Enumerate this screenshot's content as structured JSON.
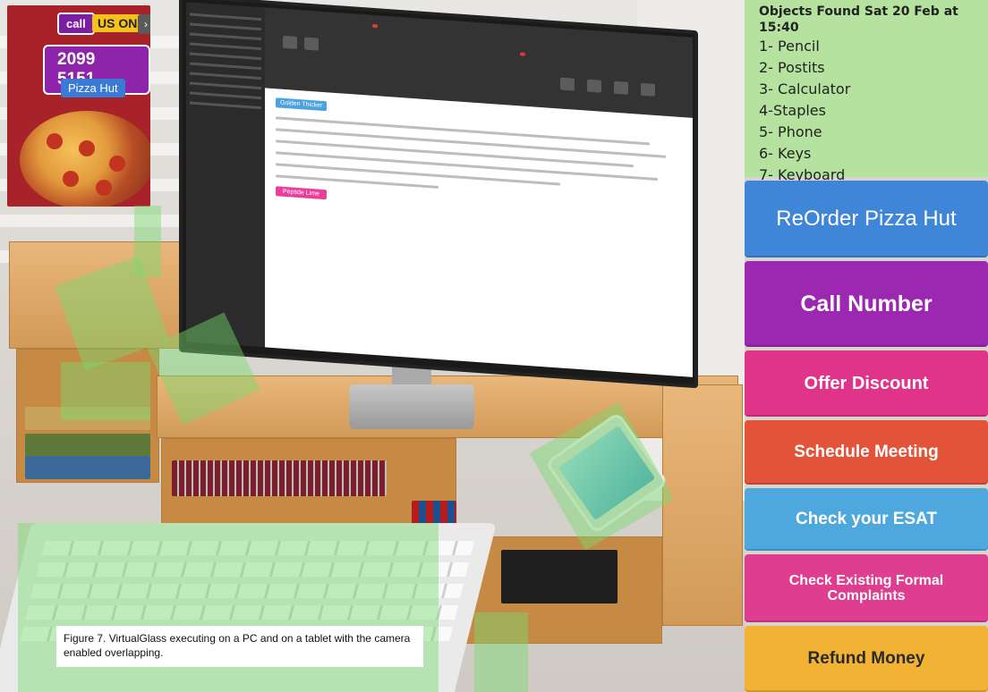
{
  "ad": {
    "call": "call",
    "uson": "US ON",
    "next": "›",
    "phone": "2099 5151",
    "brand": "Pizza Hut"
  },
  "email": {
    "button_pink": "Peptide Lime",
    "button_blue": "Golden Thicker"
  },
  "objects_found": {
    "title": "Objects Found Sat 20 Feb at 15:40",
    "items": [
      "1- Pencil",
      "2- Postits",
      "3- Calculator",
      "4-Staples",
      "5- Phone",
      "6- Keys",
      "7- Keyboard"
    ]
  },
  "actions": [
    {
      "label": "ReOrder Pizza Hut",
      "color": "#3f86d8"
    },
    {
      "label": "Call Number",
      "color": "#9c27b0"
    },
    {
      "label": "Offer Discount",
      "color": "#e0348a"
    },
    {
      "label": "Schedule Meeting",
      "color": "#e2533a"
    },
    {
      "label": "Check your ESAT",
      "color": "#4ea8dd"
    },
    {
      "label": "Check Existing Formal Complaints",
      "color": "#df3d8f"
    },
    {
      "label": "Refund Money",
      "color": "#f2b233"
    }
  ],
  "caption": {
    "text": "Figure 7. VirtualGlass executing on a PC and on a tablet with the camera enabled overlapping."
  }
}
